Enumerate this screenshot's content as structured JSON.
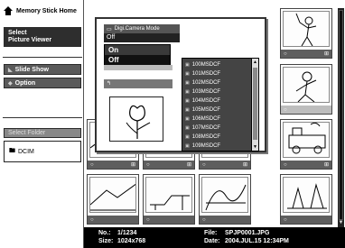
{
  "sidebar": {
    "home_label": "Memory Stick Home",
    "select_line1": "Select",
    "select_line2": "Picture Viewer",
    "slideshow_label": "Slide Show",
    "option_label": "Option",
    "select_folder_label": "Select Folder",
    "folder_name": "DCIM"
  },
  "modal": {
    "mode_label": "Digi.Camera Mode",
    "mode_value": "Off",
    "options": [
      "On",
      "Off"
    ],
    "selected_option": "Off",
    "folders": [
      "100MSDCF",
      "101MSDCF",
      "102MSDCF",
      "103MSDCF",
      "104MSDCF",
      "105MSDCF",
      "106MSDCF",
      "107MSDCF",
      "108MSDCF",
      "109MSDCF"
    ]
  },
  "info": {
    "no_label": "No.:",
    "no_value": "1/1234",
    "size_label": "Size:",
    "size_value": "1024x768",
    "file_label": "File:",
    "file_value": "SPJP0001.JPG",
    "date_label": "Date:",
    "date_value": "2004.JUL.15 12:34PM"
  },
  "icons": [
    "home-icon",
    "slideshow-icon",
    "option-icon",
    "folder-icon",
    "camera-icon",
    "scroll-down-icon"
  ]
}
